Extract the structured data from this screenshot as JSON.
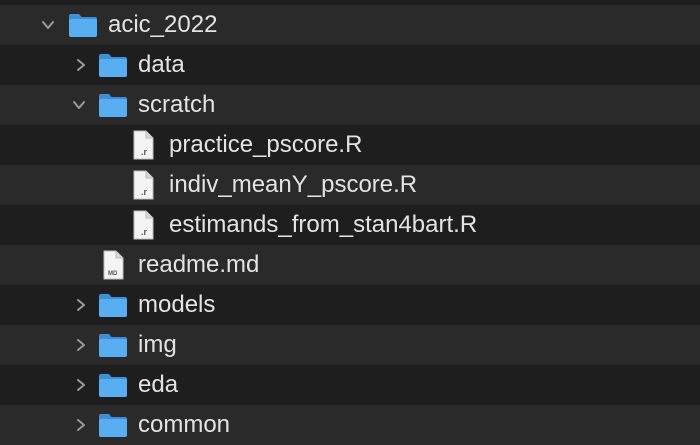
{
  "tree": {
    "items": [
      {
        "label": "acic_2022",
        "kind": "folder",
        "expanded": true
      },
      {
        "label": "data",
        "kind": "folder",
        "expanded": false
      },
      {
        "label": "scratch",
        "kind": "folder",
        "expanded": true
      },
      {
        "label": "practice_pscore.R",
        "kind": "r-file",
        "icon_text": ".r"
      },
      {
        "label": "indiv_meanY_pscore.R",
        "kind": "r-file",
        "icon_text": ".r"
      },
      {
        "label": "estimands_from_stan4bart.R",
        "kind": "r-file",
        "icon_text": ".r"
      },
      {
        "label": "readme.md",
        "kind": "md-file",
        "icon_text": "MD"
      },
      {
        "label": "models",
        "kind": "folder",
        "expanded": false
      },
      {
        "label": "img",
        "kind": "folder",
        "expanded": false
      },
      {
        "label": "eda",
        "kind": "folder",
        "expanded": false
      },
      {
        "label": "common",
        "kind": "folder",
        "expanded": false
      }
    ]
  },
  "colors": {
    "background": "#1e1e1e",
    "alt_row": "#2a2a2a",
    "text": "#e3e3e3",
    "folder": "#58aef0",
    "chevron": "#9a9a9a"
  }
}
